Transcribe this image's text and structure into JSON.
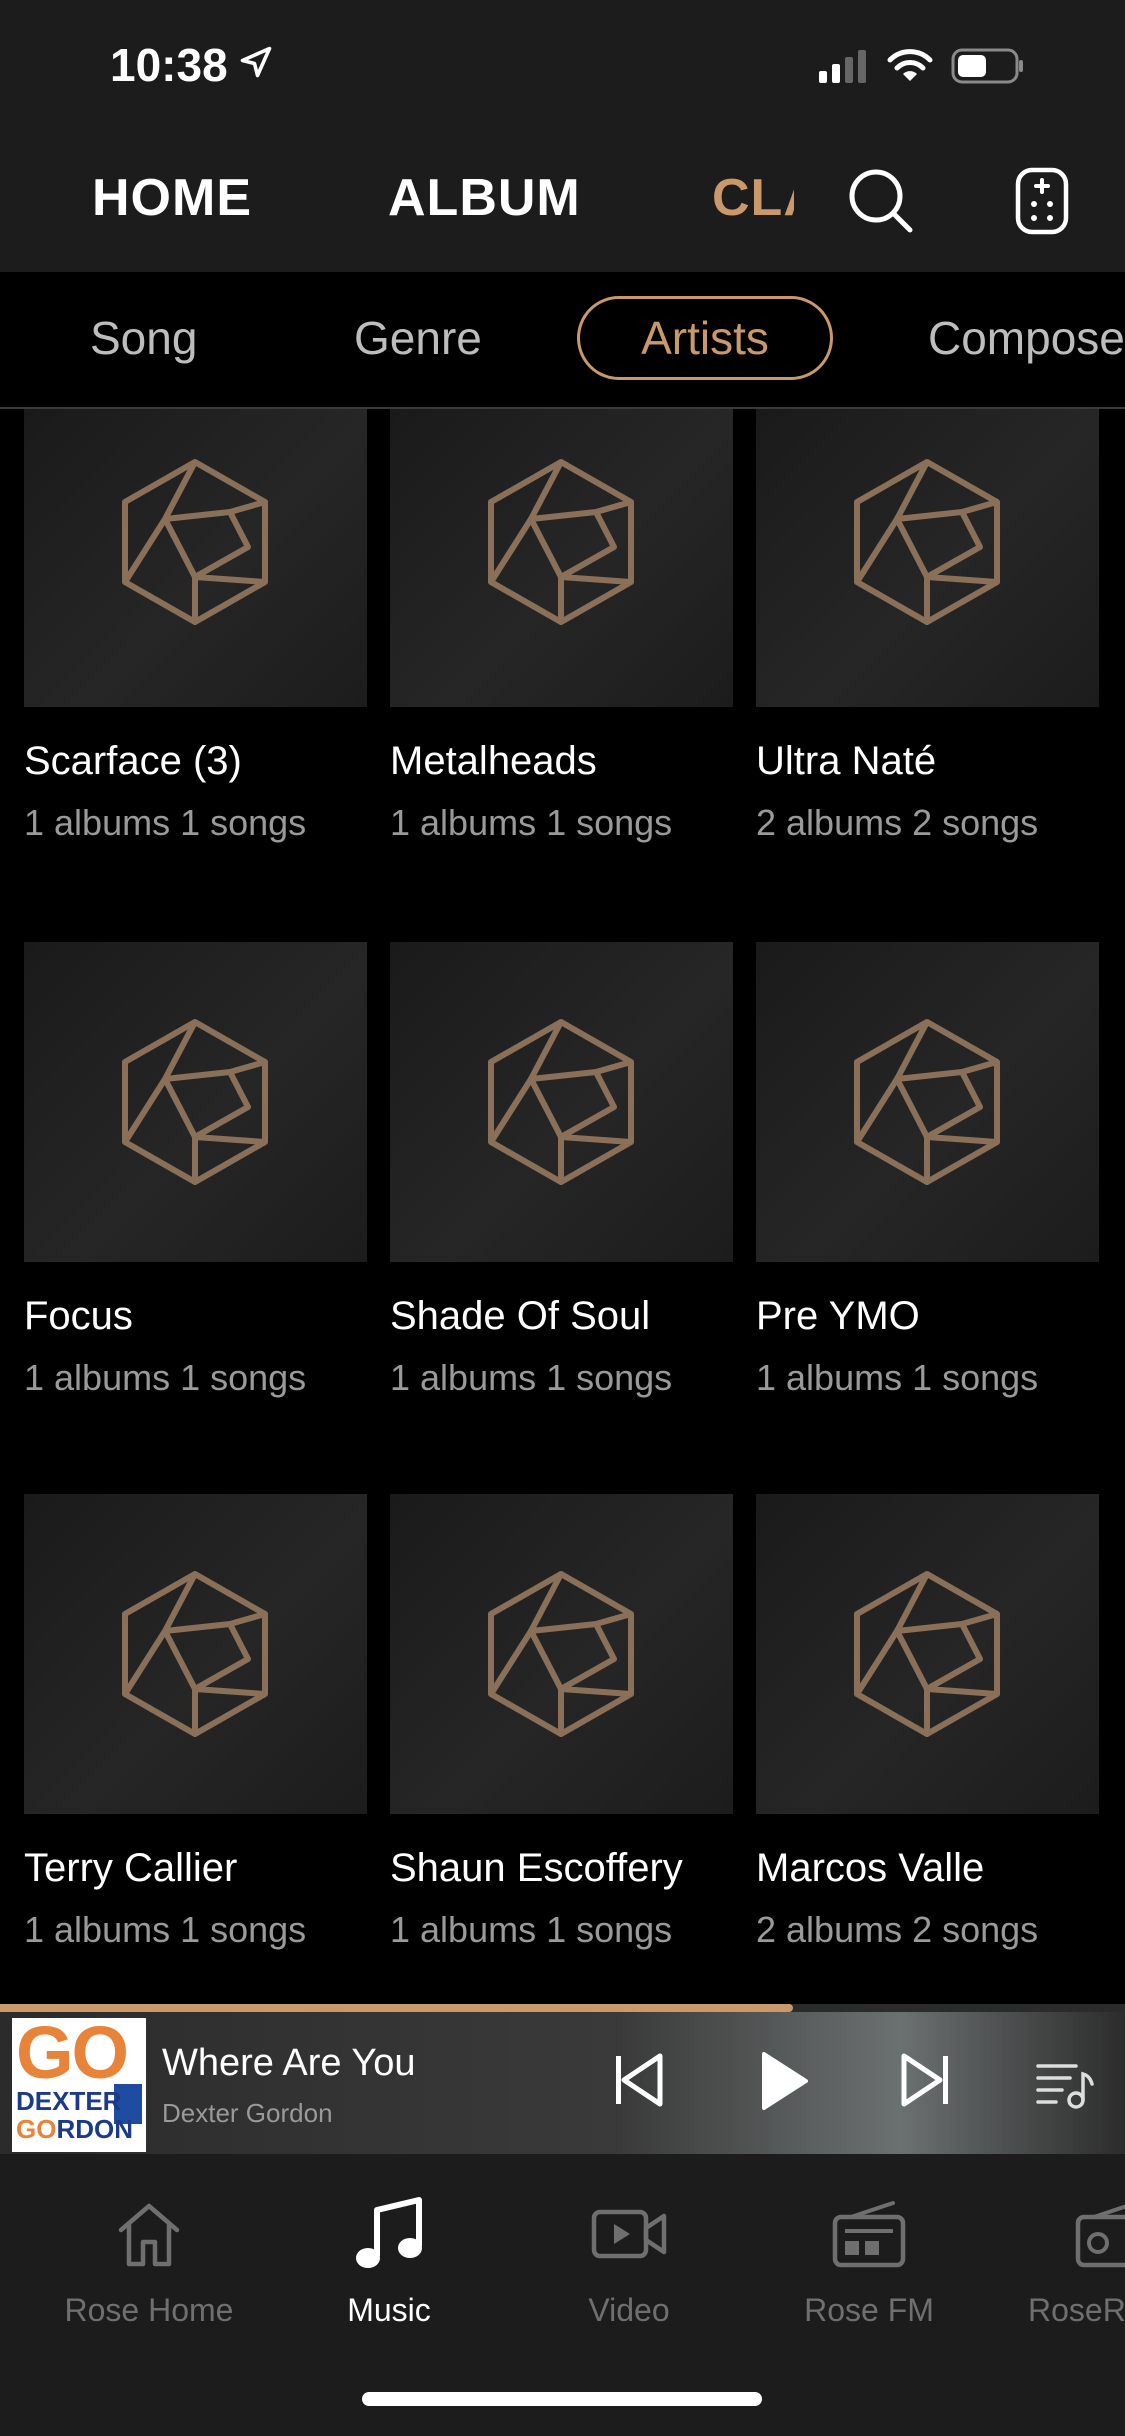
{
  "status_bar": {
    "time": "10:38"
  },
  "top_nav": {
    "tabs": [
      "HOME",
      "ALBUM",
      "CLASSIC"
    ]
  },
  "sub_tabs": [
    "Song",
    "Genre",
    "Artists",
    "Composer"
  ],
  "active_sub_tab": "Artists",
  "artists": [
    {
      "name": "Scarface (3)",
      "info": "1 albums 1 songs"
    },
    {
      "name": "Metalheads",
      "info": "1 albums 1 songs"
    },
    {
      "name": "Ultra Naté",
      "info": "2 albums 2 songs"
    },
    {
      "name": "Focus",
      "info": "1 albums 1 songs"
    },
    {
      "name": "Shade Of Soul",
      "info": "1 albums 1 songs"
    },
    {
      "name": "Pre YMO",
      "info": "1 albums 1 songs"
    },
    {
      "name": "Terry Callier",
      "info": "1 albums 1 songs"
    },
    {
      "name": "Shaun Escoffery",
      "info": "1 albums 1 songs"
    },
    {
      "name": "Marcos Valle",
      "info": "2 albums 2 songs"
    }
  ],
  "player": {
    "title": "Where Are You",
    "artist": "Dexter Gordon",
    "progress": 0.705,
    "cover_text": {
      "line1": "GO",
      "line2": "DEXTER",
      "line3_a": "GO",
      "line3_b": "RDON"
    }
  },
  "bottom_tabs": [
    {
      "label": "Rose Home",
      "icon": "house-icon"
    },
    {
      "label": "Music",
      "icon": "music-note-icon"
    },
    {
      "label": "Video",
      "icon": "video-icon"
    },
    {
      "label": "Rose FM",
      "icon": "radio-icon"
    },
    {
      "label": "RoseRadio",
      "icon": "radio-icon"
    }
  ],
  "active_bottom_tab": "Music",
  "colors": {
    "accent": "#c9996b",
    "background": "#000000",
    "bar": "#1c1c1c"
  }
}
